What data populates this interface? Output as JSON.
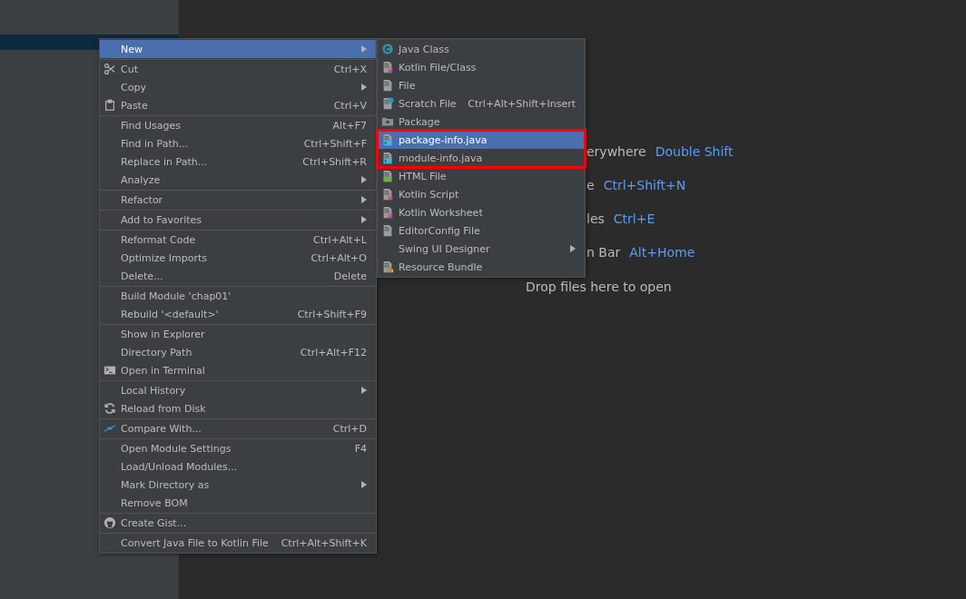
{
  "project_tree": {
    "selected_row": true
  },
  "context_menu": {
    "groups": [
      [
        {
          "label": "New",
          "submenu": true,
          "selected": true
        }
      ],
      [
        {
          "label": "Cut",
          "shortcut": "Ctrl+X",
          "selected": false
        },
        {
          "label": "Copy",
          "submenu": true,
          "selected": false
        },
        {
          "label": "Paste",
          "shortcut": "Ctrl+V",
          "selected": false
        }
      ],
      [
        {
          "label": "Find Usages",
          "shortcut": "Alt+F7",
          "selected": false
        },
        {
          "label": "Find in Path...",
          "shortcut": "Ctrl+Shift+F",
          "selected": false
        },
        {
          "label": "Replace in Path...",
          "shortcut": "Ctrl+Shift+R",
          "selected": false
        },
        {
          "label": "Analyze",
          "submenu": true,
          "selected": false
        }
      ],
      [
        {
          "label": "Refactor",
          "submenu": true,
          "selected": false
        }
      ],
      [
        {
          "label": "Add to Favorites",
          "submenu": true,
          "selected": false
        }
      ],
      [
        {
          "label": "Reformat Code",
          "shortcut": "Ctrl+Alt+L",
          "selected": false
        },
        {
          "label": "Optimize Imports",
          "shortcut": "Ctrl+Alt+O",
          "selected": false
        },
        {
          "label": "Delete...",
          "shortcut": "Delete",
          "selected": false
        }
      ],
      [
        {
          "label": "Build Module 'chap01'",
          "selected": false
        },
        {
          "label": "Rebuild '<default>'",
          "shortcut": "Ctrl+Shift+F9",
          "selected": false
        }
      ],
      [
        {
          "label": "Show in Explorer",
          "selected": false
        },
        {
          "label": "Directory Path",
          "shortcut": "Ctrl+Alt+F12",
          "selected": false
        },
        {
          "label": "Open in Terminal",
          "selected": false
        }
      ],
      [
        {
          "label": "Local History",
          "submenu": true,
          "selected": false
        },
        {
          "label": "Reload from Disk",
          "selected": false
        }
      ],
      [
        {
          "label": "Compare With...",
          "shortcut": "Ctrl+D",
          "selected": false
        }
      ],
      [
        {
          "label": "Open Module Settings",
          "shortcut": "F4",
          "selected": false
        },
        {
          "label": "Load/Unload Modules...",
          "selected": false
        },
        {
          "label": "Mark Directory as",
          "submenu": true,
          "selected": false
        },
        {
          "label": "Remove BOM",
          "selected": false
        }
      ],
      [
        {
          "label": "Create Gist...",
          "selected": false
        }
      ],
      [
        {
          "label": "Convert Java File to Kotlin File",
          "shortcut": "Ctrl+Alt+Shift+K",
          "selected": false
        }
      ]
    ]
  },
  "new_submenu": {
    "items_before": [
      {
        "label": "Java Class",
        "selected": false
      },
      {
        "label": "Kotlin File/Class",
        "selected": false
      },
      {
        "label": "File",
        "selected": false
      },
      {
        "label": "Scratch File",
        "shortcut": "Ctrl+Alt+Shift+Insert",
        "selected": false
      },
      {
        "label": "Package",
        "selected": false
      }
    ],
    "highlight_box": [
      {
        "label": "package-info.java",
        "selected": true
      },
      {
        "label": "module-info.java",
        "selected": false
      }
    ],
    "items_after": [
      {
        "label": "HTML File",
        "selected": false
      },
      {
        "label": "Kotlin Script",
        "selected": false
      },
      {
        "label": "Kotlin Worksheet",
        "selected": false
      },
      {
        "label": "EditorConfig File",
        "selected": false
      },
      {
        "label": "Swing UI Designer",
        "submenu": true,
        "selected": false
      },
      {
        "label": "Resource Bundle",
        "selected": false
      }
    ]
  },
  "editor_hints": [
    {
      "label": "erywhere",
      "shortcut": "Double Shift"
    },
    {
      "label": "e",
      "shortcut": "Ctrl+Shift+N"
    },
    {
      "label": "les",
      "shortcut": "Ctrl+E"
    },
    {
      "label": "n Bar",
      "shortcut": "Alt+Home"
    }
  ],
  "drop_hint": "Drop files here to open"
}
